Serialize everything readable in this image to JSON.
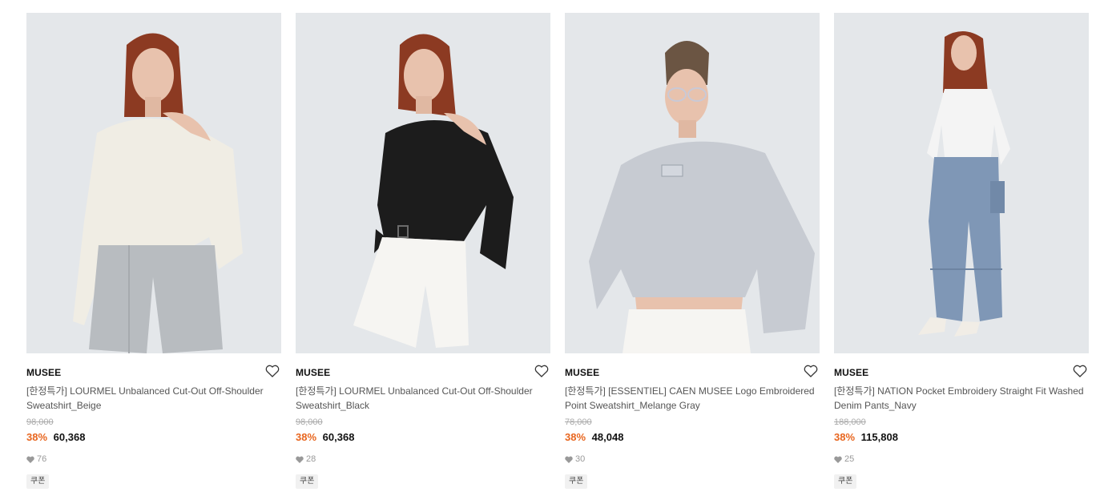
{
  "products": [
    {
      "brand": "MUSEE",
      "name": "[한정특가] LOURMEL Unbalanced Cut-Out Off-Shoulder Sweatshirt_Beige",
      "original_price": "98,000",
      "discount": "38%",
      "price": "60,368",
      "likes": "76",
      "badge": "쿠폰",
      "image_alt": "Model in beige off-shoulder sweatshirt and grey shorts"
    },
    {
      "brand": "MUSEE",
      "name": "[한정특가] LOURMEL Unbalanced Cut-Out Off-Shoulder Sweatshirt_Black",
      "original_price": "98,000",
      "discount": "38%",
      "price": "60,368",
      "likes": "28",
      "badge": "쿠폰",
      "image_alt": "Model in black off-shoulder sweatshirt and white shorts"
    },
    {
      "brand": "MUSEE",
      "name": "[한정특가] [ESSENTIEL] CAEN MUSEE Logo Embroidered Point Sweatshirt_Melange Gray",
      "original_price": "78,000",
      "discount": "38%",
      "price": "48,048",
      "likes": "30",
      "badge": "쿠폰",
      "image_alt": "Model in melange gray cropped sweatshirt with logo patch"
    },
    {
      "brand": "MUSEE",
      "name": "[한정특가] NATION Pocket Embroidery Straight Fit Washed Denim Pants_Navy",
      "original_price": "188,000",
      "discount": "38%",
      "price": "115,808",
      "likes": "25",
      "badge": "쿠폰",
      "image_alt": "Model in white top and washed navy denim pants"
    }
  ],
  "colors": {
    "discount": "#e8661f",
    "photo_bg": "#e4e7ea",
    "hair": "#8c3a22",
    "skin": "#e8c2ad"
  },
  "icons": {
    "wishlist": "heart-outline-icon",
    "likes": "heart-filled-icon"
  }
}
